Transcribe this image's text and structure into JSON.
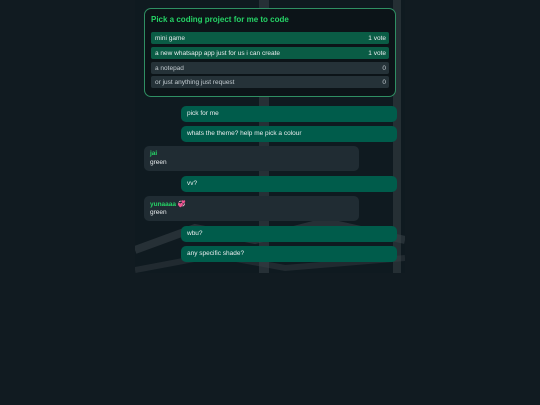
{
  "poll": {
    "title": "Pick a coding project for me to code",
    "options": [
      {
        "label": "mini game",
        "count": "1 vote"
      },
      {
        "label": "a new whatsapp app just for us i can create",
        "count": "1 vote"
      },
      {
        "label": "a notepad",
        "count": "0"
      },
      {
        "label": "or just anything just request",
        "count": "0"
      }
    ]
  },
  "messages": [
    {
      "text": "pick for me"
    },
    {
      "text": "whats the theme? help me pick a colour"
    },
    {
      "sender": "jai",
      "text": "green"
    },
    {
      "text": "vv?"
    },
    {
      "sender": "yunaaaa",
      "sender_emoji": "💞",
      "text": "green"
    },
    {
      "text": "wbu?"
    },
    {
      "text": "any specific shade?"
    }
  ],
  "colors": {
    "page_bg": "#111b21",
    "outgoing_bubble": "#005c4b",
    "incoming_bubble": "#202c33",
    "accent_green": "#25d366",
    "sender_blue": "#53bdeb"
  }
}
